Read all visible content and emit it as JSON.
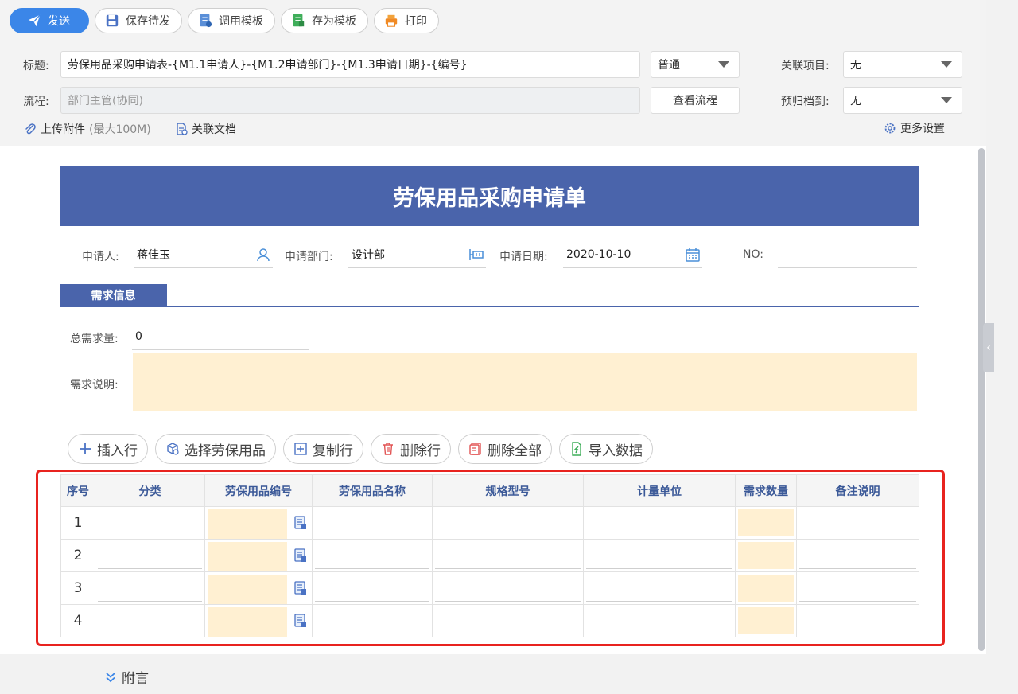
{
  "toolbar": {
    "send": "发送",
    "save_draft": "保存待发",
    "use_template": "调用模板",
    "save_template": "存为模板",
    "print": "打印"
  },
  "header": {
    "title_label": "标题:",
    "title_value": "劳保用品采购申请表-{M1.1申请人}-{M1.2申请部门}-{M1.3申请日期}-{编号}",
    "priority": "普通",
    "related_project_label": "关联项目:",
    "related_project_value": "无",
    "flow_label": "流程:",
    "flow_value": "部门主管(协同)",
    "view_flow": "查看流程",
    "archive_label": "预归档到:",
    "archive_value": "无",
    "upload": "上传附件",
    "upload_limit": "(最大100M)",
    "related_doc": "关联文档",
    "more_settings": "更多设置"
  },
  "form": {
    "title": "劳保用品采购申请单",
    "applicant_label": "申请人:",
    "applicant_value": "蒋佳玉",
    "dept_label": "申请部门:",
    "dept_value": "设计部",
    "date_label": "申请日期:",
    "date_value": "2020-10-10",
    "no_label": "NO:",
    "no_value": "",
    "section_tab": "需求信息",
    "total_label": "总需求量:",
    "total_value": "0",
    "desc_label": "需求说明:"
  },
  "actions": {
    "insert_row": "插入行",
    "select_item": "选择劳保用品",
    "copy_row": "复制行",
    "delete_row": "删除行",
    "delete_all": "删除全部",
    "import_data": "导入数据"
  },
  "table": {
    "headers": [
      "序号",
      "分类",
      "劳保用品编号",
      "劳保用品名称",
      "规格型号",
      "计量单位",
      "需求数量",
      "备注说明"
    ],
    "rows": [
      "1",
      "2",
      "3",
      "4"
    ]
  },
  "footer": {
    "attachment_note": "附言"
  },
  "colors": {
    "primary": "#3b86e8",
    "banner": "#4a64ab",
    "required_fill": "#fff0d2",
    "highlight": "#e8231f"
  }
}
